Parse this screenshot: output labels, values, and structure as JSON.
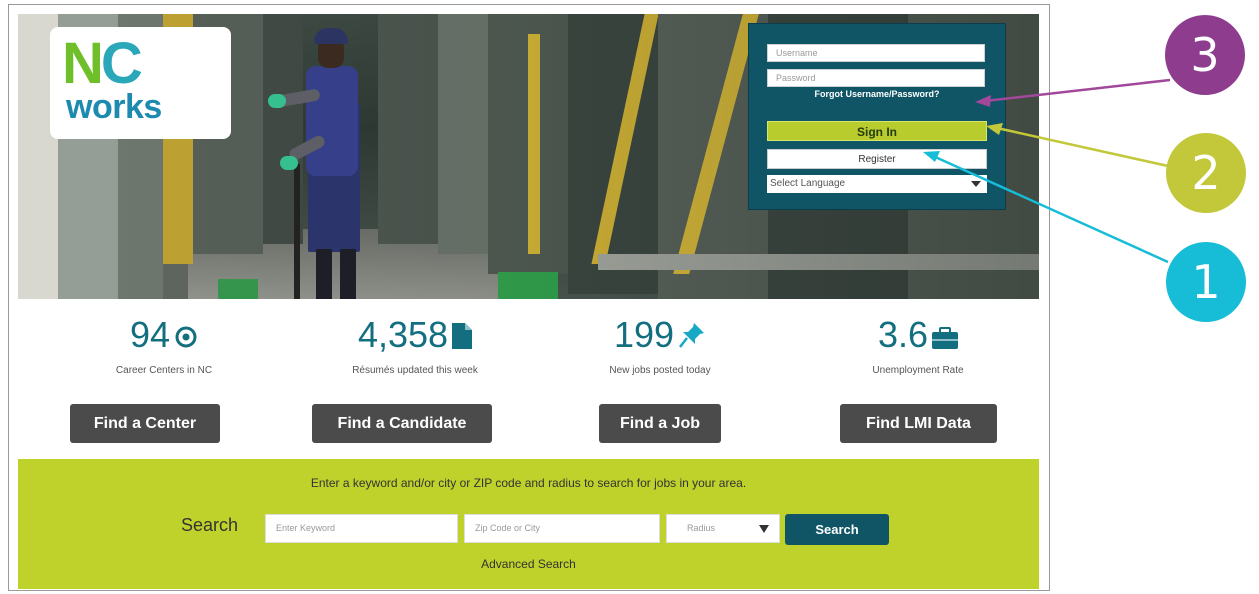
{
  "login": {
    "username_placeholder": "Username",
    "password_placeholder": "Password",
    "forgot_link": "Forgot Username/Password?",
    "signin_button": "Sign In",
    "register_button": "Register",
    "language_select": "Select Language"
  },
  "stats": [
    {
      "value": "94",
      "caption": "Career Centers in NC",
      "button": "Find a Center",
      "icon": "target-icon"
    },
    {
      "value": "4,358",
      "caption": "Résumés updated this week",
      "button": "Find a Candidate",
      "icon": "document-icon"
    },
    {
      "value": "199",
      "caption": "New jobs posted today",
      "button": "Find a Job",
      "icon": "pushpin-icon"
    },
    {
      "value": "3.6",
      "caption": "Unemployment Rate",
      "button": "Find LMI Data",
      "icon": "briefcase-icon"
    }
  ],
  "search": {
    "help_text": "Enter a keyword and/or city or ZIP code and radius to search for jobs in your area.",
    "label": "Search",
    "keyword_placeholder": "Enter Keyword",
    "location_placeholder": "Zip Code or City",
    "radius_placeholder": "Radius",
    "button": "Search",
    "advanced_link": "Advanced Search"
  },
  "callouts": [
    {
      "label": "3",
      "color": "#8e3c8e"
    },
    {
      "label": "2",
      "color": "#c3c73a"
    },
    {
      "label": "1",
      "color": "#17bcd6"
    }
  ],
  "colors": {
    "teal": "#0f5566",
    "lime": "#bfd12b",
    "button_gray": "#4b4b4b",
    "stat_blue": "#136f80"
  }
}
